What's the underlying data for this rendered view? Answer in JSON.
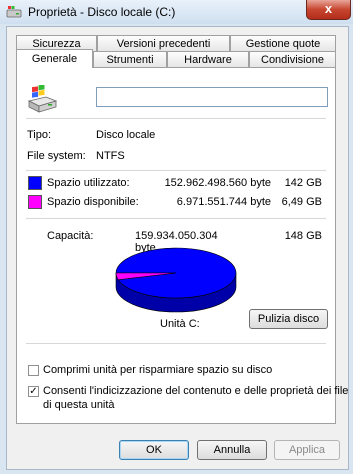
{
  "window": {
    "title": "Proprietà - Disco locale (C:)",
    "close_label": "x"
  },
  "tabs": {
    "row1": [
      "Sicurezza",
      "Versioni precedenti",
      "Gestione quote"
    ],
    "row2": [
      "Generale",
      "Strumenti",
      "Hardware",
      "Condivisione"
    ],
    "active": "Generale"
  },
  "general": {
    "name_value": "",
    "type_label": "Tipo:",
    "type_value": "Disco locale",
    "fs_label": "File system:",
    "fs_value": "NTFS",
    "used_label": "Spazio utilizzato:",
    "used_bytes": "152.962.498.560 byte",
    "used_gb": "142 GB",
    "free_label": "Spazio disponibile:",
    "free_bytes": "6.971.551.744 byte",
    "free_gb": "6,49 GB",
    "capacity_label": "Capacità:",
    "capacity_bytes": "159.934.050.304 byte",
    "capacity_gb": "148 GB",
    "drive_label": "Unità C:",
    "cleanup_button": "Pulizia disco",
    "compress_label": "Comprimi unità per risparmiare spazio su disco",
    "compress_checked": false,
    "index_label_1": "Consenti l'indicizzazione del contenuto e delle proprietà dei file",
    "index_label_2": "di questa unità",
    "index_checked": true
  },
  "chart_data": {
    "type": "pie",
    "categories": [
      "Spazio utilizzato",
      "Spazio disponibile"
    ],
    "values": [
      152962498560,
      6971551744
    ],
    "colors": [
      "#0000ff",
      "#ff00ff"
    ]
  },
  "buttons": {
    "ok": "OK",
    "cancel": "Annulla",
    "apply": "Applica"
  },
  "colors": {
    "used": "#0000ff",
    "free": "#ff00ff"
  }
}
